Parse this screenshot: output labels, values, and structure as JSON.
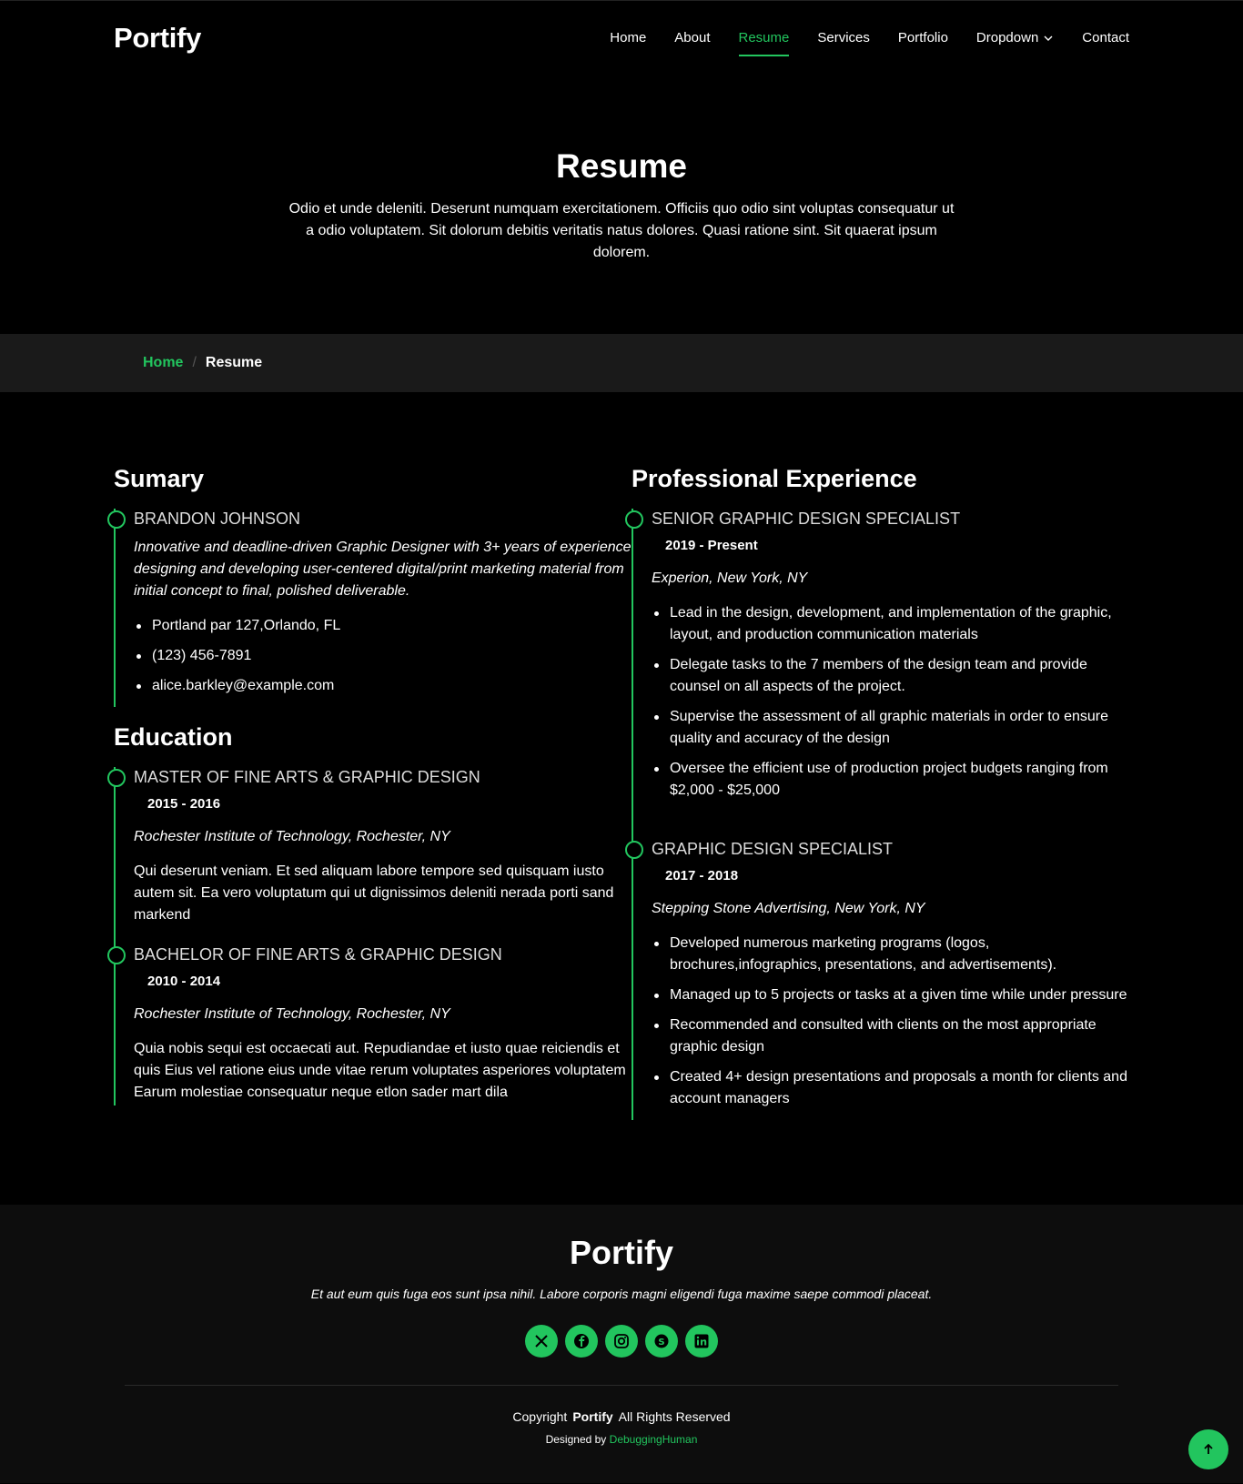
{
  "brand": "Portify",
  "nav": {
    "home": "Home",
    "about": "About",
    "resume": "Resume",
    "services": "Services",
    "portfolio": "Portfolio",
    "dropdown": "Dropdown",
    "contact": "Contact"
  },
  "hero": {
    "title": "Resume",
    "text": "Odio et unde deleniti. Deserunt numquam exercitationem. Officiis quo odio sint voluptas consequatur ut a odio voluptatem. Sit dolorum debitis veritatis natus dolores. Quasi ratione sint. Sit quaerat ipsum dolorem."
  },
  "breadcrumb": {
    "home": "Home",
    "sep": "/",
    "current": "Resume"
  },
  "summary": {
    "heading": "Sumary",
    "name": "BRANDON JOHNSON",
    "intro": "Innovative and deadline-driven Graphic Designer with 3+ years of experience designing and developing user-centered digital/print marketing material from initial concept to final, polished deliverable.",
    "contacts": [
      "Portland par 127,Orlando, FL",
      "(123) 456-7891",
      "alice.barkley@example.com"
    ]
  },
  "education": {
    "heading": "Education",
    "items": [
      {
        "title": "MASTER OF FINE ARTS & GRAPHIC DESIGN",
        "years": "2015 - 2016",
        "place": "Rochester Institute of Technology, Rochester, NY",
        "text": "Qui deserunt veniam. Et sed aliquam labore tempore sed quisquam iusto autem sit. Ea vero voluptatum qui ut dignissimos deleniti nerada porti sand markend"
      },
      {
        "title": "BACHELOR OF FINE ARTS & GRAPHIC DESIGN",
        "years": "2010 - 2014",
        "place": "Rochester Institute of Technology, Rochester, NY",
        "text": "Quia nobis sequi est occaecati aut. Repudiandae et iusto quae reiciendis et quis Eius vel ratione eius unde vitae rerum voluptates asperiores voluptatem Earum molestiae consequatur neque etlon sader mart dila"
      }
    ]
  },
  "experience": {
    "heading": "Professional Experience",
    "items": [
      {
        "title": "SENIOR GRAPHIC DESIGN SPECIALIST",
        "years": "2019 - Present",
        "place": "Experion, New York, NY",
        "bullets": [
          "Lead in the design, development, and implementation of the graphic, layout, and production communication materials",
          "Delegate tasks to the 7 members of the design team and provide counsel on all aspects of the project.",
          "Supervise the assessment of all graphic materials in order to ensure quality and accuracy of the design",
          "Oversee the efficient use of production project budgets ranging from $2,000 - $25,000"
        ]
      },
      {
        "title": "GRAPHIC DESIGN SPECIALIST",
        "years": "2017 - 2018",
        "place": "Stepping Stone Advertising, New York, NY",
        "bullets": [
          "Developed numerous marketing programs (logos, brochures,infographics, presentations, and advertisements).",
          "Managed up to 5 projects or tasks at a given time while under pressure",
          "Recommended and consulted with clients on the most appropriate graphic design",
          "Created 4+ design presentations and proposals a month for clients and account managers"
        ]
      }
    ]
  },
  "footer": {
    "brand": "Portify",
    "tagline": "Et aut eum quis fuga eos sunt ipsa nihil. Labore corporis magni eligendi fuga maxime saepe commodi placeat.",
    "socials": [
      "x-icon",
      "facebook-icon",
      "instagram-icon",
      "skype-icon",
      "linkedin-icon"
    ],
    "copyright_pre": "Copyright",
    "copyright_brand": "Portify",
    "copyright_post": "All Rights Reserved",
    "designed_by": "Designed by",
    "designer": "DebuggingHuman"
  },
  "colors": {
    "accent": "#22c55e",
    "bg": "#000000",
    "footer_bg": "#0d0d0d",
    "breadcrumb_bg": "#1a1a1a"
  }
}
